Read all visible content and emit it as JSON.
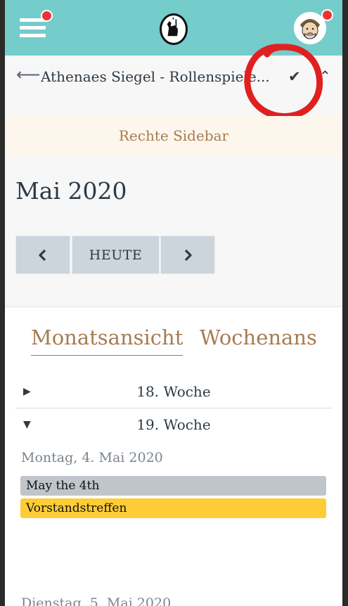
{
  "header": {
    "menu_icon": "hamburger-icon",
    "logo_icon": "athena-logo",
    "avatar_icon": "user-avatar"
  },
  "subheader": {
    "back_icon": "arrow-left-icon",
    "title": "Athenaes Siegel - Rollenspiele...",
    "check_icon": "check-icon",
    "collapse_icon": "chevron-up-icon"
  },
  "right_sidebar": {
    "label": "Rechte Sidebar"
  },
  "calendar": {
    "month_title": "Mai 2020",
    "today_label": "HEUTE",
    "tabs": [
      "Monatsansicht",
      "Wochenans"
    ],
    "weeks": [
      {
        "label": "18. Woche",
        "expanded": false
      },
      {
        "label": "19. Woche",
        "expanded": true
      }
    ],
    "days": [
      {
        "label": "Montag, 4. Mai 2020",
        "events": [
          {
            "title": "May the 4th",
            "color": "#bfc5ca"
          },
          {
            "title": "Vorstandstreffen",
            "color": "#fecd35"
          }
        ]
      },
      {
        "label": "Dienstag, 5. Mai 2020"
      }
    ]
  },
  "colors": {
    "topbar": "#74cccb",
    "accent": "#a67c52",
    "notification": "#ee3333",
    "annotation": "#e02020"
  }
}
